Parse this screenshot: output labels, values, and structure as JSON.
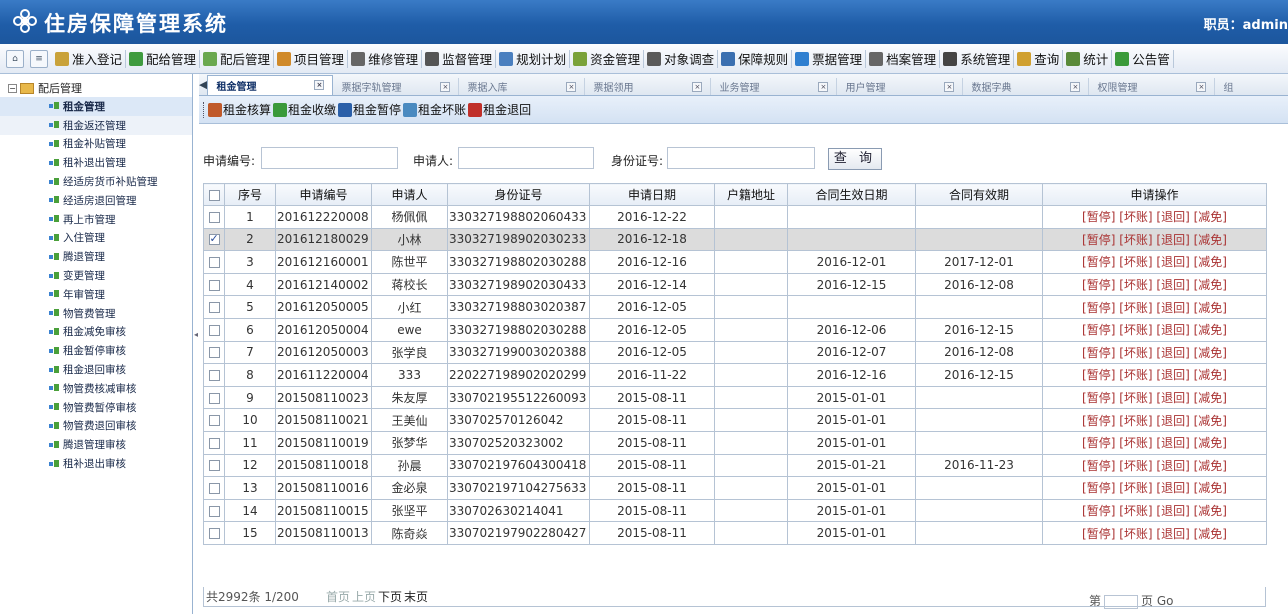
{
  "header": {
    "title": "住房保障管理系统",
    "user": "职员：admin"
  },
  "menu": [
    {
      "label": "准入登记",
      "icon": "pen-icon",
      "color": "#c9a23a"
    },
    {
      "label": "配给管理",
      "icon": "allocation-icon",
      "color": "#3f9b3f"
    },
    {
      "label": "配后管理",
      "icon": "after-allocation-icon",
      "color": "#6aa84f"
    },
    {
      "label": "项目管理",
      "icon": "project-icon",
      "color": "#d08a2a"
    },
    {
      "label": "维修管理",
      "icon": "repair-icon",
      "color": "#666666"
    },
    {
      "label": "监督管理",
      "icon": "monitor-icon",
      "color": "#555555"
    },
    {
      "label": "规划计划",
      "icon": "plan-icon",
      "color": "#4a7fbf"
    },
    {
      "label": "资金管理",
      "icon": "yen-icon",
      "color": "#7aa23a"
    },
    {
      "label": "对象调查",
      "icon": "survey-icon",
      "color": "#5a5a5a"
    },
    {
      "label": "保障规则",
      "icon": "rules-icon",
      "color": "#3a6fb0"
    },
    {
      "label": "票据管理",
      "icon": "bill-icon",
      "color": "#2f7fd0"
    },
    {
      "label": "档案管理",
      "icon": "archive-icon",
      "color": "#666666"
    },
    {
      "label": "系统管理",
      "icon": "system-icon",
      "color": "#444444"
    },
    {
      "label": "查询",
      "icon": "query-icon",
      "color": "#d0a030"
    },
    {
      "label": "统计",
      "icon": "stats-icon",
      "color": "#5a8a3a"
    },
    {
      "label": "公告管",
      "icon": "notice-icon",
      "color": "#3a9a3a"
    }
  ],
  "sidebar": {
    "root": "配后管理",
    "items": [
      "租金管理",
      "租金返还管理",
      "租金补贴管理",
      "租补退出管理",
      "经适房货币补贴管理",
      "经适房退回管理",
      "再上市管理",
      "入住管理",
      "腾退管理",
      "变更管理",
      "年审管理",
      "物管费管理",
      "租金减免审核",
      "租金暂停审核",
      "租金退回审核",
      "物管费核减审核",
      "物管费暂停审核",
      "物管费退回审核",
      "腾退管理审核",
      "租补退出审核"
    ]
  },
  "tabs": [
    "租金管理",
    "票据字轨管理",
    "票据入库",
    "票据领用",
    "业务管理",
    "用户管理",
    "数据字典",
    "权限管理",
    "组"
  ],
  "toolbar": [
    {
      "label": "租金核算",
      "icon": "calculate-icon",
      "color": "#c05a2a"
    },
    {
      "label": "租金收缴",
      "icon": "collect-icon",
      "color": "#3a9a3a"
    },
    {
      "label": "租金暂停",
      "icon": "save-icon",
      "color": "#2a5fa8"
    },
    {
      "label": "租金坏账",
      "icon": "table-icon",
      "color": "#4a8ac0"
    },
    {
      "label": "租金退回",
      "icon": "return-icon",
      "color": "#c0302a"
    }
  ],
  "search": {
    "code_label": "申请编号:",
    "code_value": "",
    "applicant_label": "申请人:",
    "applicant_value": "",
    "id_label": "身份证号:",
    "id_value": "",
    "button": "查 询"
  },
  "table": {
    "headers": [
      "",
      "序号",
      "申请编号",
      "申请人",
      "身份证号",
      "申请日期",
      "户籍地址",
      "合同生效日期",
      "合同有效期",
      "申请操作"
    ],
    "op_label": "[暂停] [坏账] [退回] [减免]",
    "rows": [
      {
        "no": "1",
        "code": "201612220008",
        "name": "杨佩佩",
        "id": "330327198802060433",
        "date": "2016-12-22",
        "addr": "",
        "start": "",
        "end": "",
        "checked": false
      },
      {
        "no": "2",
        "code": "201612180029",
        "name": "小林",
        "id": "330327198902030233",
        "date": "2016-12-18",
        "addr": "",
        "start": "",
        "end": "",
        "checked": true
      },
      {
        "no": "3",
        "code": "201612160001",
        "name": "陈世平",
        "id": "330327198802030288",
        "date": "2016-12-16",
        "addr": "",
        "start": "2016-12-01",
        "end": "2017-12-01",
        "checked": false
      },
      {
        "no": "4",
        "code": "201612140002",
        "name": "蒋校长",
        "id": "330327198902030433",
        "date": "2016-12-14",
        "addr": "",
        "start": "2016-12-15",
        "end": "2016-12-08",
        "checked": false
      },
      {
        "no": "5",
        "code": "201612050005",
        "name": "小红",
        "id": "330327198803020387",
        "date": "2016-12-05",
        "addr": "",
        "start": "",
        "end": "",
        "checked": false
      },
      {
        "no": "6",
        "code": "201612050004",
        "name": "ewe",
        "id": "330327198802030288",
        "date": "2016-12-05",
        "addr": "",
        "start": "2016-12-06",
        "end": "2016-12-15",
        "checked": false
      },
      {
        "no": "7",
        "code": "201612050003",
        "name": "张学良",
        "id": "330327199003020388",
        "date": "2016-12-05",
        "addr": "",
        "start": "2016-12-07",
        "end": "2016-12-08",
        "checked": false
      },
      {
        "no": "8",
        "code": "201611220004",
        "name": "333",
        "id": "220227198902020299",
        "date": "2016-11-22",
        "addr": "",
        "start": "2016-12-16",
        "end": "2016-12-15",
        "checked": false
      },
      {
        "no": "9",
        "code": "201508110023",
        "name": "朱友厚",
        "id": "330702195512260093",
        "date": "2015-08-11",
        "addr": "",
        "start": "2015-01-01",
        "end": "",
        "checked": false
      },
      {
        "no": "10",
        "code": "201508110021",
        "name": "王美仙",
        "id": "330702570126042",
        "date": "2015-08-11",
        "addr": "",
        "start": "2015-01-01",
        "end": "",
        "checked": false
      },
      {
        "no": "11",
        "code": "201508110019",
        "name": "张梦华",
        "id": "330702520323002",
        "date": "2015-08-11",
        "addr": "",
        "start": "2015-01-01",
        "end": "",
        "checked": false
      },
      {
        "no": "12",
        "code": "201508110018",
        "name": "孙晨",
        "id": "330702197604300418",
        "date": "2015-08-11",
        "addr": "",
        "start": "2015-01-21",
        "end": "2016-11-23",
        "checked": false
      },
      {
        "no": "13",
        "code": "201508110016",
        "name": "金必泉",
        "id": "330702197104275633",
        "date": "2015-08-11",
        "addr": "",
        "start": "2015-01-01",
        "end": "",
        "checked": false
      },
      {
        "no": "14",
        "code": "201508110015",
        "name": "张坚平",
        "id": "330702630214041",
        "date": "2015-08-11",
        "addr": "",
        "start": "2015-01-01",
        "end": "",
        "checked": false
      },
      {
        "no": "15",
        "code": "201508110013",
        "name": "陈奇焱",
        "id": "330702197902280427",
        "date": "2015-08-11",
        "addr": "",
        "start": "2015-01-01",
        "end": "",
        "checked": false
      }
    ]
  },
  "pager": {
    "info": "共2992条  1/200",
    "first": "首页",
    "prev": "上页",
    "next": "下页",
    "last": "末页",
    "goto_prefix": "第",
    "goto_suffix": "页 Go"
  }
}
